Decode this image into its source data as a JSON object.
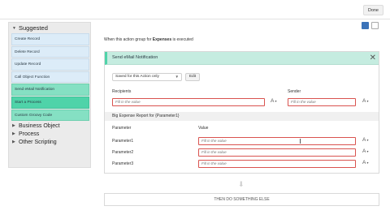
{
  "topbar": {
    "done_label": "Done"
  },
  "sidebar": {
    "suggested_label": "Suggested",
    "items": [
      {
        "label": "Create Record",
        "state": "normal"
      },
      {
        "label": "Delete Record",
        "state": "normal"
      },
      {
        "label": "Update Record",
        "state": "normal"
      },
      {
        "label": "Call Object Function",
        "state": "normal"
      },
      {
        "label": "Send eMail Notification",
        "state": "highlight"
      },
      {
        "label": "Start a Process",
        "state": "active"
      },
      {
        "label": "Custom Groovy Code",
        "state": "highlight"
      }
    ],
    "groups": [
      {
        "label": "Business Object"
      },
      {
        "label": "Process"
      },
      {
        "label": "Other Scripting"
      }
    ]
  },
  "intro": {
    "prefix": "When this action group for ",
    "object": "Expenses",
    "suffix": " is executed"
  },
  "card": {
    "title": "Send eMail Notification",
    "close_glyph": "✕",
    "select_value": "Saved for this Action only",
    "edit_label": "Edit",
    "recipients_label": "Recipients",
    "sender_label": "Sender",
    "placeholder": "Fill in the value",
    "format_glyph": "A",
    "subsection_title": "Big Expense Report for {Parameter1}",
    "parameter_header": "Parameter",
    "value_header": "Value",
    "parameters": [
      "Parameter1",
      "Parameter2",
      "Parameter3"
    ]
  },
  "footer": {
    "then_label": "THEN DO SOMETHING ELSE"
  },
  "colors": {
    "accent": "#4fd3a9",
    "panel": "#c5ece0",
    "error_border": "#d9534f",
    "item_bg": "#dcecf8"
  },
  "icons": [
    "grid-view-icon",
    "list-view-icon",
    "close-icon",
    "font-format-icon",
    "down-arrow-icon"
  ]
}
